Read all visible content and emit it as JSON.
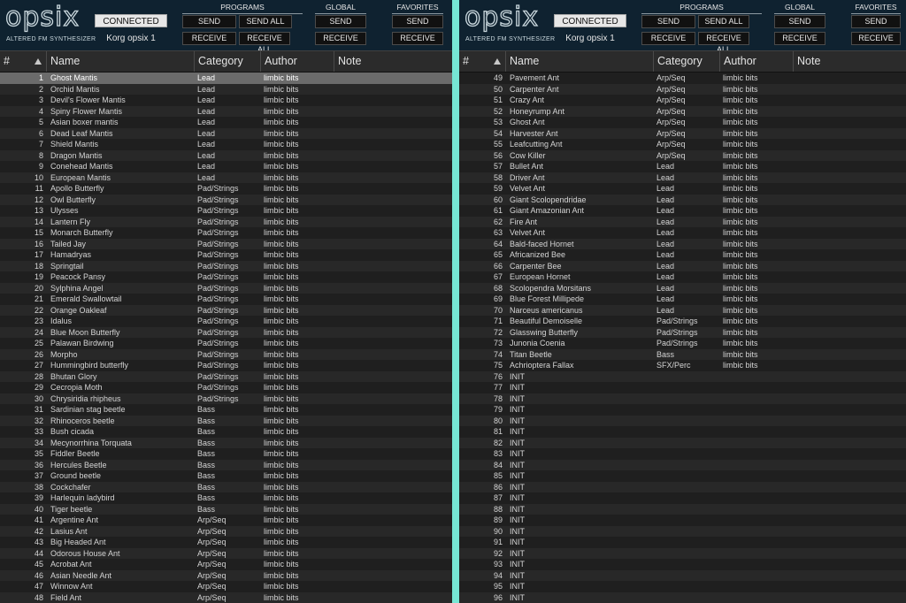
{
  "header": {
    "logo": "opsix",
    "subtitle": "ALTERED FM SYNTHESIZER",
    "status": "CONNECTED",
    "device": "Korg opsix 1",
    "programs_label": "PROGRAMS",
    "global_label": "GLOBAL",
    "favorites_label": "FAVORITES",
    "send": "SEND",
    "send_all": "SEND ALL",
    "receive": "RECEIVE",
    "receive_all": "RECEIVE ALL"
  },
  "columns": {
    "num": "#",
    "name": "Name",
    "category": "Category",
    "author": "Author",
    "note": "Note"
  },
  "left_rows": [
    [
      "1",
      "Ghost Mantis",
      "Lead",
      "limbic bits"
    ],
    [
      "2",
      "Orchid Mantis",
      "Lead",
      "limbic bits"
    ],
    [
      "3",
      "Devil's Flower Mantis",
      "Lead",
      "limbic bits"
    ],
    [
      "4",
      "Spiny Flower Mantis",
      "Lead",
      "limbic bits"
    ],
    [
      "5",
      "Asian boxer mantis",
      "Lead",
      "limbic bits"
    ],
    [
      "6",
      "Dead Leaf Mantis",
      "Lead",
      "limbic bits"
    ],
    [
      "7",
      "Shield Mantis",
      "Lead",
      "limbic bits"
    ],
    [
      "8",
      "Dragon Mantis",
      "Lead",
      "limbic bits"
    ],
    [
      "9",
      "Conehead Mantis",
      "Lead",
      "limbic bits"
    ],
    [
      "10",
      "European Mantis",
      "Lead",
      "limbic bits"
    ],
    [
      "11",
      "Apollo Butterfly",
      "Pad/Strings",
      "limbic bits"
    ],
    [
      "12",
      "Owl Butterfly",
      "Pad/Strings",
      "limbic bits"
    ],
    [
      "13",
      "Ulysses",
      "Pad/Strings",
      "limbic bits"
    ],
    [
      "14",
      "Lantern Fly",
      "Pad/Strings",
      "limbic bits"
    ],
    [
      "15",
      "Monarch Butterfly",
      "Pad/Strings",
      "limbic bits"
    ],
    [
      "16",
      "Tailed Jay",
      "Pad/Strings",
      "limbic bits"
    ],
    [
      "17",
      "Hamadryas",
      "Pad/Strings",
      "limbic bits"
    ],
    [
      "18",
      "Springtail",
      "Pad/Strings",
      "limbic bits"
    ],
    [
      "19",
      "Peacock Pansy",
      "Pad/Strings",
      "limbic bits"
    ],
    [
      "20",
      "Sylphina Angel",
      "Pad/Strings",
      "limbic bits"
    ],
    [
      "21",
      "Emerald Swallowtail",
      "Pad/Strings",
      "limbic bits"
    ],
    [
      "22",
      "Orange Oakleaf",
      "Pad/Strings",
      "limbic bits"
    ],
    [
      "23",
      "Idalus",
      "Pad/Strings",
      "limbic bits"
    ],
    [
      "24",
      "Blue Moon Butterfly",
      "Pad/Strings",
      "limbic bits"
    ],
    [
      "25",
      "Palawan Birdwing",
      "Pad/Strings",
      "limbic bits"
    ],
    [
      "26",
      "Morpho",
      "Pad/Strings",
      "limbic bits"
    ],
    [
      "27",
      "Hummingbird butterfly",
      "Pad/Strings",
      "limbic bits"
    ],
    [
      "28",
      "Bhutan Glory",
      "Pad/Strings",
      "limbic bits"
    ],
    [
      "29",
      "Cecropia Moth",
      "Pad/Strings",
      "limbic bits"
    ],
    [
      "30",
      "Chrysiridia rhipheus",
      "Pad/Strings",
      "limbic bits"
    ],
    [
      "31",
      "Sardinian stag beetle",
      "Bass",
      "limbic bits"
    ],
    [
      "32",
      "Rhinoceros beetle",
      "Bass",
      "limbic bits"
    ],
    [
      "33",
      "Bush cicada",
      "Bass",
      "limbic bits"
    ],
    [
      "34",
      "Mecynorrhina Torquata",
      "Bass",
      "limbic bits"
    ],
    [
      "35",
      "Fiddler Beetle",
      "Bass",
      "limbic bits"
    ],
    [
      "36",
      "Hercules Beetle",
      "Bass",
      "limbic bits"
    ],
    [
      "37",
      "Ground beetle",
      "Bass",
      "limbic bits"
    ],
    [
      "38",
      "Cockchafer",
      "Bass",
      "limbic bits"
    ],
    [
      "39",
      "Harlequin ladybird",
      "Bass",
      "limbic bits"
    ],
    [
      "40",
      "Tiger beetle",
      "Bass",
      "limbic bits"
    ],
    [
      "41",
      "Argentine Ant",
      "Arp/Seq",
      "limbic bits"
    ],
    [
      "42",
      "Lasius Ant",
      "Arp/Seq",
      "limbic bits"
    ],
    [
      "43",
      "Big Headed Ant",
      "Arp/Seq",
      "limbic bits"
    ],
    [
      "44",
      "Odorous House Ant",
      "Arp/Seq",
      "limbic bits"
    ],
    [
      "45",
      "Acrobat Ant",
      "Arp/Seq",
      "limbic bits"
    ],
    [
      "46",
      "Asian Needle Ant",
      "Arp/Seq",
      "limbic bits"
    ],
    [
      "47",
      "Winnow Ant",
      "Arp/Seq",
      "limbic bits"
    ],
    [
      "48",
      "Field Ant",
      "Arp/Seq",
      "limbic bits"
    ]
  ],
  "right_rows": [
    [
      "49",
      "Pavement Ant",
      "Arp/Seq",
      "limbic bits"
    ],
    [
      "50",
      "Carpenter Ant",
      "Arp/Seq",
      "limbic bits"
    ],
    [
      "51",
      "Crazy Ant",
      "Arp/Seq",
      "limbic bits"
    ],
    [
      "52",
      "Honeyrump Ant",
      "Arp/Seq",
      "limbic bits"
    ],
    [
      "53",
      "Ghost Ant",
      "Arp/Seq",
      "limbic bits"
    ],
    [
      "54",
      "Harvester Ant",
      "Arp/Seq",
      "limbic bits"
    ],
    [
      "55",
      "Leafcutting Ant",
      "Arp/Seq",
      "limbic bits"
    ],
    [
      "56",
      "Cow Killer",
      "Arp/Seq",
      "limbic bits"
    ],
    [
      "57",
      "Bullet Ant",
      "Lead",
      "limbic bits"
    ],
    [
      "58",
      "Driver Ant",
      "Lead",
      "limbic bits"
    ],
    [
      "59",
      "Velvet Ant",
      "Lead",
      "limbic bits"
    ],
    [
      "60",
      "Giant Scolopendridae",
      "Lead",
      "limbic bits"
    ],
    [
      "61",
      "Giant Amazonian Ant",
      "Lead",
      "limbic bits"
    ],
    [
      "62",
      "Fire Ant",
      "Lead",
      "limbic bits"
    ],
    [
      "63",
      "Velvet Ant",
      "Lead",
      "limbic bits"
    ],
    [
      "64",
      "Bald-faced Hornet",
      "Lead",
      "limbic bits"
    ],
    [
      "65",
      "Africanized Bee",
      "Lead",
      "limbic bits"
    ],
    [
      "66",
      "Carpenter Bee",
      "Lead",
      "limbic bits"
    ],
    [
      "67",
      "European Hornet",
      "Lead",
      "limbic bits"
    ],
    [
      "68",
      "Scolopendra Morsitans",
      "Lead",
      "limbic bits"
    ],
    [
      "69",
      "Blue Forest Millipede",
      "Lead",
      "limbic bits"
    ],
    [
      "70",
      "Narceus americanus",
      "Lead",
      "limbic bits"
    ],
    [
      "71",
      "Beautiful Demoiselle",
      "Pad/Strings",
      "limbic bits"
    ],
    [
      "72",
      "Glasswing Butterfly",
      "Pad/Strings",
      "limbic bits"
    ],
    [
      "73",
      "Junonia Coenia",
      "Pad/Strings",
      "limbic bits"
    ],
    [
      "74",
      "Titan Beetle",
      "Bass",
      "limbic bits"
    ],
    [
      "75",
      "Achrioptera Fallax",
      "SFX/Perc",
      "limbic bits"
    ],
    [
      "76",
      "INIT",
      "",
      ""
    ],
    [
      "77",
      "INIT",
      "",
      ""
    ],
    [
      "78",
      "INIT",
      "",
      ""
    ],
    [
      "79",
      "INIT",
      "",
      ""
    ],
    [
      "80",
      "INIT",
      "",
      ""
    ],
    [
      "81",
      "INIT",
      "",
      ""
    ],
    [
      "82",
      "INIT",
      "",
      ""
    ],
    [
      "83",
      "INIT",
      "",
      ""
    ],
    [
      "84",
      "INIT",
      "",
      ""
    ],
    [
      "85",
      "INIT",
      "",
      ""
    ],
    [
      "86",
      "INIT",
      "",
      ""
    ],
    [
      "87",
      "INIT",
      "",
      ""
    ],
    [
      "88",
      "INIT",
      "",
      ""
    ],
    [
      "89",
      "INIT",
      "",
      ""
    ],
    [
      "90",
      "INIT",
      "",
      ""
    ],
    [
      "91",
      "INIT",
      "",
      ""
    ],
    [
      "92",
      "INIT",
      "",
      ""
    ],
    [
      "93",
      "INIT",
      "",
      ""
    ],
    [
      "94",
      "INIT",
      "",
      ""
    ],
    [
      "95",
      "INIT",
      "",
      ""
    ],
    [
      "96",
      "INIT",
      "",
      ""
    ]
  ],
  "selected_row": "1",
  "colors": {
    "header_bg": "#0f2230",
    "divider": "#76e6d4",
    "selected_row": "#6b6b6b"
  }
}
